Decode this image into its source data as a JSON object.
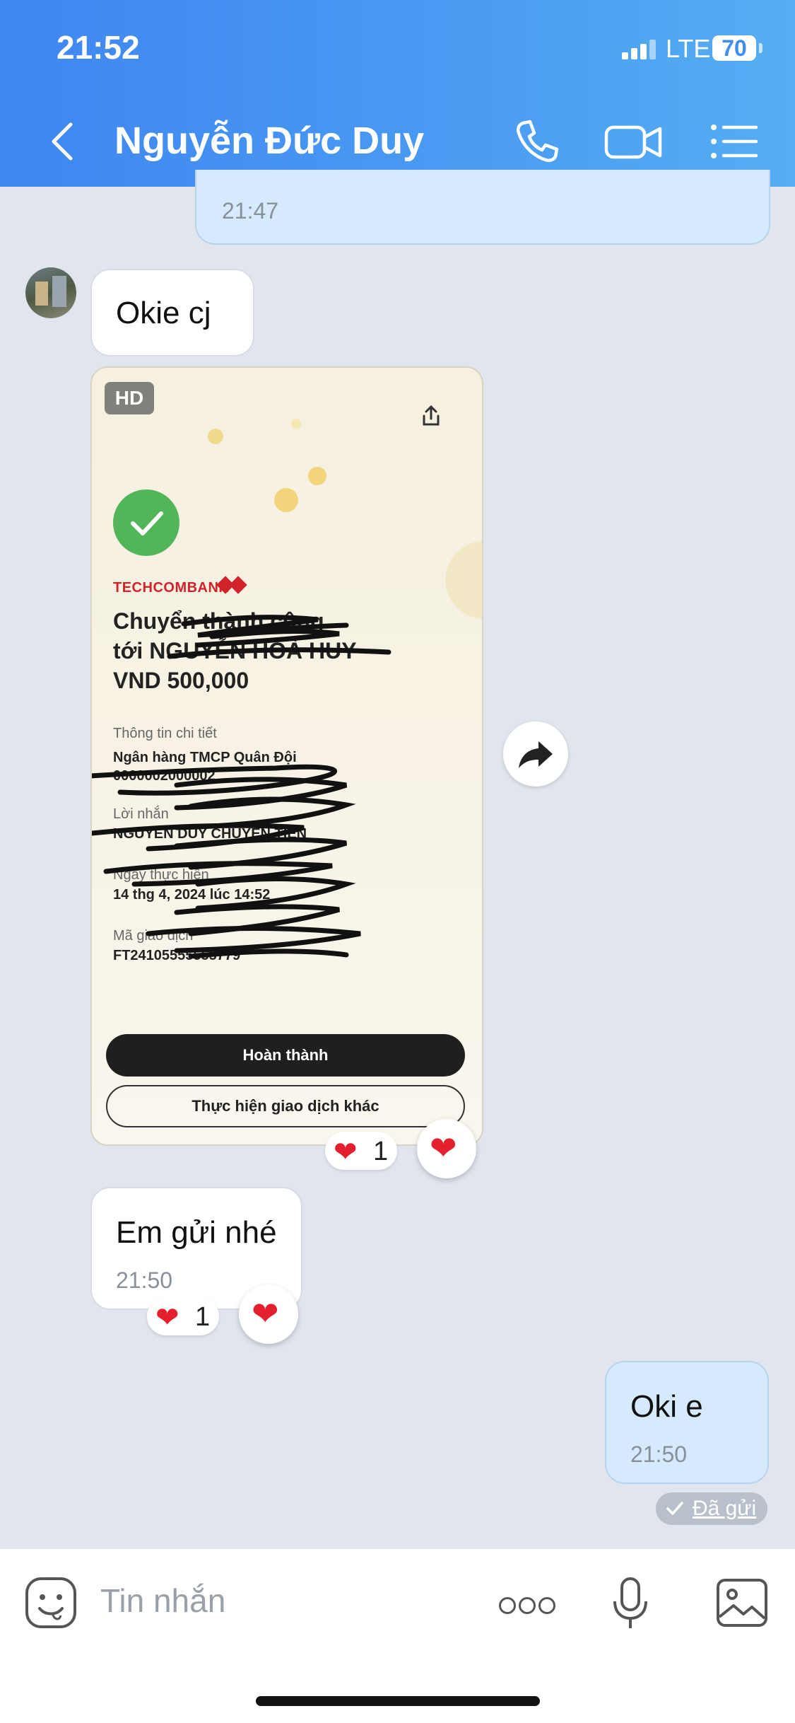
{
  "status_bar": {
    "time": "21:52",
    "network": "LTE",
    "battery": "70"
  },
  "header": {
    "title": "Nguyễn Đức Duy",
    "icons": [
      "back-arrow-icon",
      "phone-icon",
      "video-call-icon",
      "menu-list-icon"
    ]
  },
  "messages": {
    "prev_out_time": "21:47",
    "okie": "Okie cj",
    "image": {
      "hd_badge": "HD",
      "bank": "TECHCOMBANK",
      "line1": "Chuyển thành công",
      "line2": "tới NGUYỄN HOÀ HUY",
      "amount": "VND 500,000",
      "details_title": "Thông tin chi tiết",
      "bank_line": "Ngân hàng TMCP Quân Đội",
      "account": "0000002000002",
      "message_label": "Lời nhắn",
      "message_value": "NGUYEN DUY CHUYEN TIEN",
      "date_label": "Ngày thực hiện",
      "date_value": "14 thg 4, 2024 lúc 14:52",
      "txn_label": "Mã giao dịch",
      "txn_value": "FT24105555555779",
      "btn_done": "Hoàn thành",
      "btn_other": "Thực hiện giao dịch khác"
    },
    "image_reaction_count": "1",
    "em_gui_text": "Em gửi nhé",
    "em_gui_time": "21:50",
    "em_gui_reaction_count": "1",
    "oki_text": "Oki e",
    "oki_time": "21:50",
    "sent_status": "Đã gửi"
  },
  "input": {
    "placeholder": "Tin nhắn"
  },
  "colors": {
    "header": "#4a9cf2",
    "out_bubble": "#d5ebfd",
    "heart": "#e5202e",
    "check_green": "#52b55a"
  }
}
